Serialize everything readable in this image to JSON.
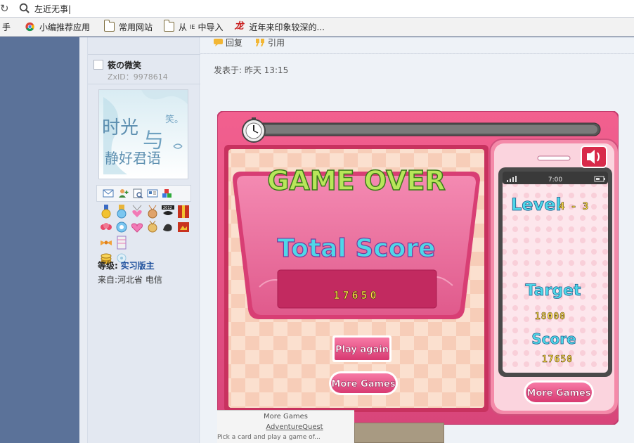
{
  "browser": {
    "address_text": "左近无事|",
    "bookmarks": [
      {
        "label": "手",
        "icon": "folder-icon"
      },
      {
        "label": "小编推荐应用",
        "icon": "chrome-icon"
      },
      {
        "label": "常用网站",
        "icon": "folder-icon"
      },
      {
        "label": "从",
        "ie_label": "IE",
        "suffix": "中导入",
        "icon": "folder-icon"
      },
      {
        "label": "近年来印象较深的...",
        "icon": "dragon-char-icon"
      }
    ],
    "dragon_char": "龙"
  },
  "post": {
    "reply_label": "回复",
    "quote_label": "引用",
    "posted_at": "发表于: 昨天 13:15"
  },
  "user": {
    "name": "筱の微笑",
    "zxid": "ZxID：9978614",
    "avatar_text_top": "时光",
    "avatar_text_mid": "与",
    "avatar_text_bottom": "静好君语",
    "avatar_text_side": "笑。",
    "level_label": "等级:",
    "level_value": "实习版主",
    "from_label": "来自:河北省 电信"
  },
  "game": {
    "title": "GAME OVER",
    "total_score_label": "Total Score",
    "total_score": "17650",
    "play_again_label": "Play again",
    "more_games_label": "More Games",
    "phone_time": "7:00",
    "level_label": "Level",
    "level_value": "4 - 3",
    "target_label": "Target",
    "target_value": "18000",
    "score_label": "Score",
    "score_value": "17650",
    "phone_more_games_label": "More Games",
    "timer_progress": 1.0,
    "colors": {
      "frame": "#e85a8a",
      "panel": "#f07aa6",
      "title_green": "#b8e65a",
      "score_yellow": "#ffe14a",
      "cyan": "#4fd7e8"
    }
  },
  "footer": {
    "more_games": "More Games",
    "link": "AdventureQuest",
    "note": "Pick a card and play a game of..."
  }
}
